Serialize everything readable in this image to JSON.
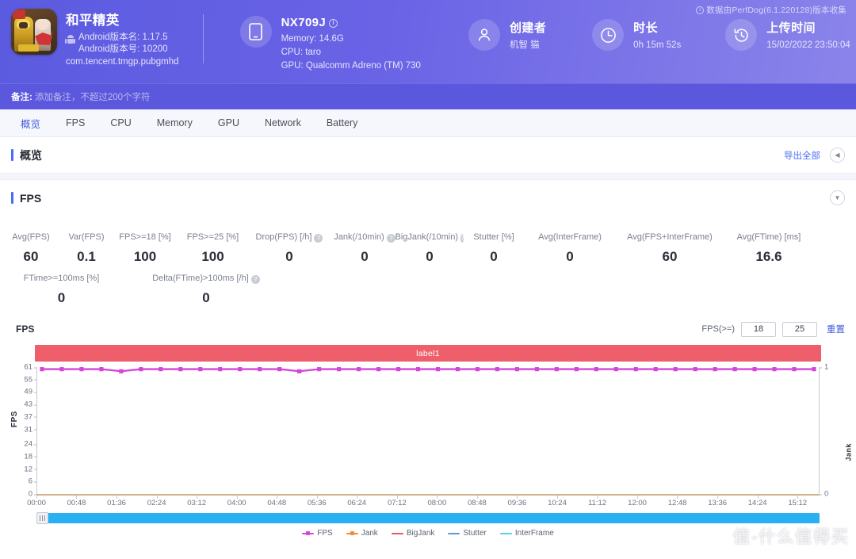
{
  "header": {
    "watermark_note": "数据由PerfDog(6.1.220128)版本收集",
    "app": {
      "name": "和平精英",
      "version_name": "Android版本名: 1.17.5",
      "version_code": "Android版本号: 10200",
      "package": "com.tencent.tmgp.pubgmhd"
    },
    "device": {
      "model": "NX709J",
      "memory": "Memory: 14.6G",
      "cpu": "CPU: taro",
      "gpu": "GPU: Qualcomm Adreno (TM) 730"
    },
    "creator": {
      "title": "创建者",
      "value": "机智 猫"
    },
    "duration": {
      "title": "时长",
      "value": "0h 15m 52s"
    },
    "upload": {
      "title": "上传时间",
      "value": "15/02/2022 23:50:04"
    }
  },
  "remark": {
    "label": "备注:",
    "placeholder": "添加备注，不超过200个字符"
  },
  "tabs": [
    {
      "label": "概览",
      "active": true
    },
    {
      "label": "FPS",
      "active": false
    },
    {
      "label": "CPU",
      "active": false
    },
    {
      "label": "Memory",
      "active": false
    },
    {
      "label": "GPU",
      "active": false
    },
    {
      "label": "Network",
      "active": false
    },
    {
      "label": "Battery",
      "active": false
    }
  ],
  "overview_section": {
    "title": "概览",
    "export_label": "导出全部",
    "collapse_icon": "◀"
  },
  "fps_section": {
    "title": "FPS",
    "collapse_icon": "▼"
  },
  "metrics": {
    "row1": [
      {
        "label": "Avg(FPS)",
        "value": "60",
        "help": false
      },
      {
        "label": "Var(FPS)",
        "value": "0.1",
        "help": false
      },
      {
        "label": "FPS>=18 [%]",
        "value": "100",
        "help": false
      },
      {
        "label": "FPS>=25 [%]",
        "value": "100",
        "help": false
      },
      {
        "label": "Drop(FPS) [/h]",
        "value": "0",
        "help": true
      },
      {
        "label": "Jank\n(/10min)",
        "value": "0",
        "help": true
      },
      {
        "label": "BigJank\n(/10min)",
        "value": "0",
        "help": true
      },
      {
        "label": "Stutter [%]",
        "value": "0",
        "help": false
      },
      {
        "label": "Avg(InterFrame)",
        "value": "0",
        "help": false
      },
      {
        "label": "Avg(FPS+InterFrame)",
        "value": "60",
        "help": false
      },
      {
        "label": "Avg(FTime) [ms]",
        "value": "16.6",
        "help": false
      }
    ],
    "row2": [
      {
        "label": "FTime>=100ms [%]",
        "value": "0",
        "help": false
      },
      {
        "label": "Delta(FTime)>100ms [/h]",
        "value": "0",
        "help": true
      }
    ]
  },
  "chart_panel": {
    "name": "FPS",
    "threshold_label": "FPS(>=)",
    "threshold1": "18",
    "threshold2": "25",
    "reset_label": "重置",
    "label_bar_text": "label1"
  },
  "chart_data": {
    "type": "line",
    "title": "FPS",
    "xlabel": "",
    "ylabel": "FPS",
    "y2label": "Jank",
    "ylim": [
      0,
      61
    ],
    "y2lim": [
      0,
      1
    ],
    "yticks": [
      0,
      6,
      12,
      18,
      24,
      31,
      37,
      43,
      49,
      55,
      61
    ],
    "y2ticks": [
      0,
      1
    ],
    "grid": false,
    "legend_position": "bottom",
    "xticks": [
      "00:00",
      "00:48",
      "01:36",
      "02:24",
      "03:12",
      "04:00",
      "04:48",
      "05:36",
      "06:24",
      "07:12",
      "08:00",
      "08:48",
      "09:36",
      "10:24",
      "11:12",
      "12:00",
      "12:48",
      "13:36",
      "14:24",
      "15:12"
    ],
    "series": [
      {
        "name": "FPS",
        "color": "#d645d6",
        "axis": "left",
        "x": [
          "00:00",
          "00:24",
          "00:48",
          "01:12",
          "01:36",
          "02:00",
          "02:24",
          "02:48",
          "03:12",
          "03:36",
          "04:00",
          "04:24",
          "04:48",
          "05:12",
          "05:36",
          "06:00",
          "06:24",
          "06:48",
          "07:12",
          "07:36",
          "08:00",
          "08:24",
          "08:48",
          "09:12",
          "09:36",
          "10:00",
          "10:24",
          "10:48",
          "11:12",
          "11:36",
          "12:00",
          "12:24",
          "12:48",
          "13:12",
          "13:36",
          "14:00",
          "14:24",
          "14:48",
          "15:12",
          "15:36"
        ],
        "values": [
          60,
          60,
          60,
          60,
          59,
          60,
          60,
          60,
          60,
          60,
          60,
          60,
          60,
          59,
          60,
          60,
          60,
          60,
          60,
          60,
          60,
          60,
          60,
          60,
          60,
          60,
          60,
          60,
          60,
          60,
          60,
          60,
          60,
          60,
          60,
          60,
          60,
          60,
          60,
          60
        ]
      },
      {
        "name": "Jank",
        "color": "#f08a3c",
        "axis": "right",
        "values": []
      },
      {
        "name": "BigJank",
        "color": "#e8565f",
        "axis": "right",
        "values": []
      },
      {
        "name": "Stutter",
        "color": "#5b9bd5",
        "axis": "right",
        "values": []
      },
      {
        "name": "InterFrame",
        "color": "#5ed0d8",
        "axis": "right",
        "values": []
      }
    ],
    "legend": [
      {
        "name": "FPS",
        "color": "#d645d6"
      },
      {
        "name": "Jank",
        "color": "#f08a3c"
      },
      {
        "name": "BigJank",
        "color": "#e8565f"
      },
      {
        "name": "Stutter",
        "color": "#5b9bd5"
      },
      {
        "name": "InterFrame",
        "color": "#5ed0d8"
      }
    ]
  },
  "watermark": "值-什么值得买"
}
